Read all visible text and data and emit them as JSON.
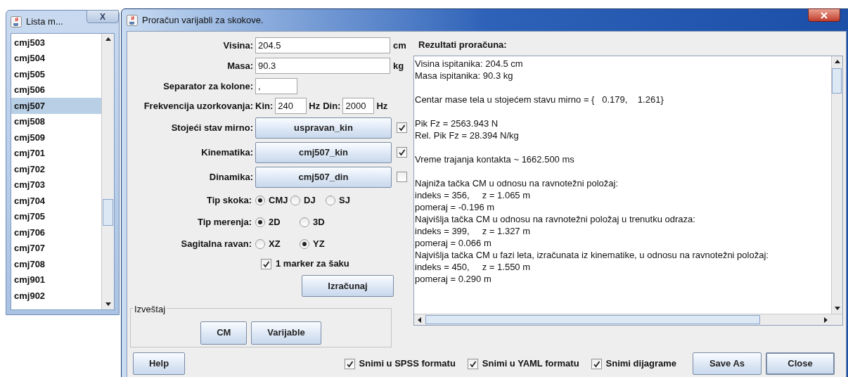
{
  "list_window": {
    "title": "Lista m...",
    "close": "X",
    "items": [
      {
        "label": "cmj503",
        "selected": false
      },
      {
        "label": "cmj504",
        "selected": false
      },
      {
        "label": "cmj505",
        "selected": false
      },
      {
        "label": "cmj506",
        "selected": false
      },
      {
        "label": "cmj507",
        "selected": true
      },
      {
        "label": "cmj508",
        "selected": false
      },
      {
        "label": "cmj509",
        "selected": false
      },
      {
        "label": "cmj701",
        "selected": false
      },
      {
        "label": "cmj702",
        "selected": false
      },
      {
        "label": "cmj703",
        "selected": false
      },
      {
        "label": "cmj704",
        "selected": false
      },
      {
        "label": "cmj705",
        "selected": false
      },
      {
        "label": "cmj706",
        "selected": false
      },
      {
        "label": "cmj707",
        "selected": false
      },
      {
        "label": "cmj708",
        "selected": false
      },
      {
        "label": "cmj901",
        "selected": false
      },
      {
        "label": "cmj902",
        "selected": false
      }
    ]
  },
  "main_window": {
    "title": "Proračun varijabli za skokove.",
    "fields": [
      {
        "label": "Visina:",
        "value": "204.5",
        "unit": "cm"
      },
      {
        "label": "Masa:",
        "value": "90.3",
        "unit": "kg"
      },
      {
        "label": "Separator za kolone:",
        "value": ","
      }
    ],
    "sampling": {
      "label": "Frekvencija uzorkovanja:",
      "inputs": [
        {
          "label": "Kin:",
          "value": "240",
          "unit": "Hz"
        },
        {
          "label": "Din:",
          "value": "2000",
          "unit": "Hz"
        }
      ]
    },
    "files": [
      {
        "label": "Stojeći stav mirno:",
        "button": "uspravan_kin",
        "checked": true
      },
      {
        "label": "Kinematika:",
        "button": "cmj507_kin",
        "checked": true
      },
      {
        "label": "Dinamika:",
        "button": "cmj507_din",
        "checked": false
      }
    ],
    "radio_groups": [
      {
        "label": "Tip skoka:",
        "options": [
          {
            "label": "CMJ",
            "selected": true
          },
          {
            "label": "DJ",
            "selected": false
          },
          {
            "label": "SJ",
            "selected": false
          }
        ]
      },
      {
        "label": "Tip merenja:",
        "options": [
          {
            "label": "2D",
            "selected": true
          },
          {
            "label": "3D",
            "selected": false
          }
        ]
      },
      {
        "label": "Sagitalna ravan:",
        "options": [
          {
            "label": "XZ",
            "selected": false
          },
          {
            "label": "YZ",
            "selected": true
          }
        ]
      }
    ],
    "hand_marker": {
      "label": "1 marker za šaku",
      "checked": true
    },
    "compute_button": "Izračunaj",
    "report": {
      "title": "Izveštaj",
      "buttons": [
        "CM",
        "Varijable"
      ]
    },
    "results": {
      "title": "Rezultati proračuna:",
      "blocks": [
        [
          "Visina ispitanika: 204.5 cm",
          "Masa ispitanika: 90.3 kg"
        ],
        [
          "Centar mase tela u stojećem stavu mirno = {   0.179,    1.261}"
        ],
        [
          "Pik Fz = 2563.943 N",
          "Rel. Pik Fz = 28.394 N/kg"
        ],
        [
          "Vreme trajanja kontakta ~ 1662.500 ms"
        ],
        [
          "Najniža tačka CM u odnosu na ravnotežni položaj:",
          "indeks = 356,     z = 1.065 m",
          "pomeraj = -0.196 m",
          "Najvišlja tačka CM u odnosu na ravnotežni položaj u trenutku odraza:",
          "indeks = 399,     z = 1.327 m",
          "pomeraj = 0.066 m",
          "Najvišlja tačka CM u fazi leta, izračunata iz kinematike, u odnosu na ravnotežni položaj:",
          "indeks = 450,     z = 1.550 m",
          "pomeraj = 0.290 m"
        ]
      ]
    },
    "bottom": {
      "help": "Help",
      "options": [
        {
          "label": "Snimi u SPSS formatu",
          "checked": true
        },
        {
          "label": "Snimi u YAML formatu",
          "checked": true
        },
        {
          "label": "Snimi dijagrame",
          "checked": true
        }
      ],
      "buttons": [
        {
          "label": "Save As",
          "default": false
        },
        {
          "label": "Close",
          "default": true
        }
      ]
    }
  }
}
